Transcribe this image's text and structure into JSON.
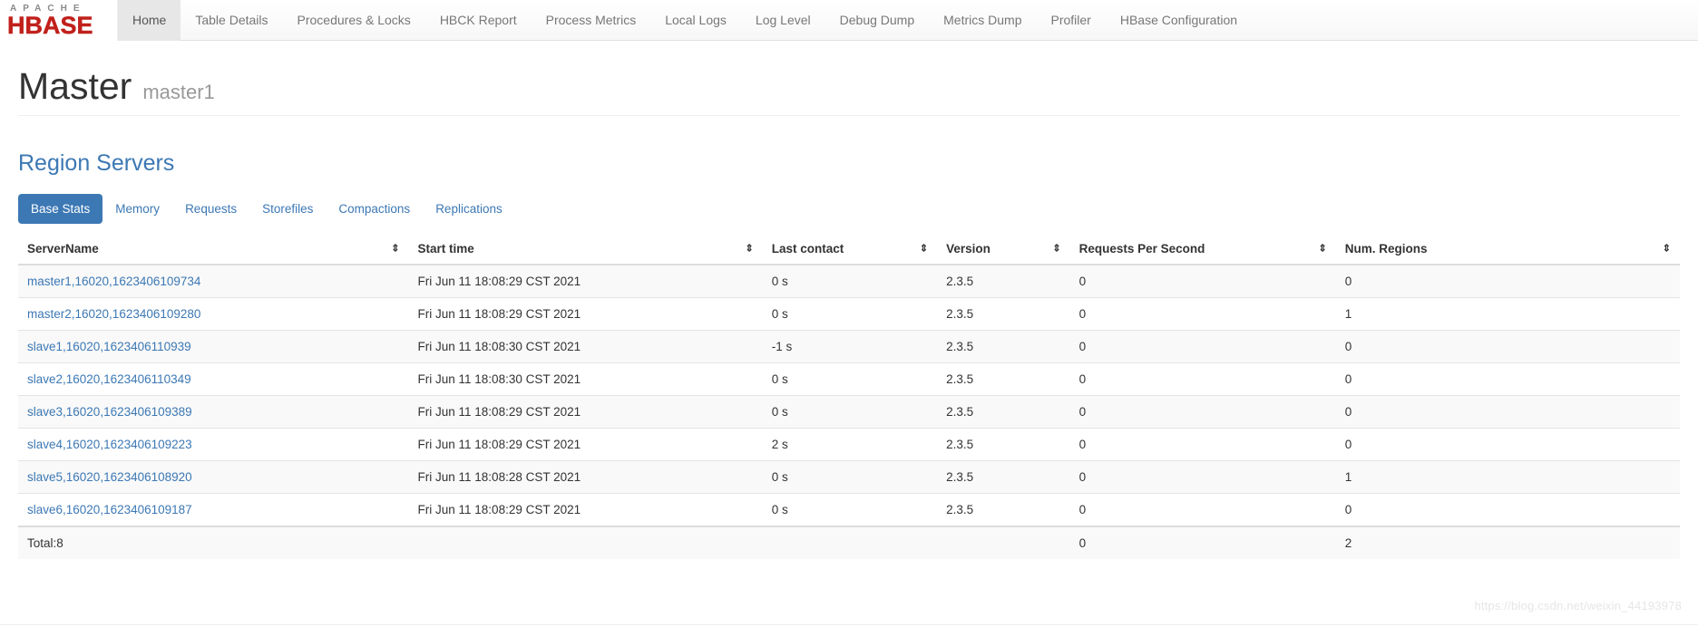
{
  "navbar": {
    "brand": {
      "top_text": "APACHE",
      "bottom_text": "HBASE"
    },
    "items": [
      {
        "label": "Home",
        "active": true
      },
      {
        "label": "Table Details",
        "active": false
      },
      {
        "label": "Procedures & Locks",
        "active": false
      },
      {
        "label": "HBCK Report",
        "active": false
      },
      {
        "label": "Process Metrics",
        "active": false
      },
      {
        "label": "Local Logs",
        "active": false
      },
      {
        "label": "Log Level",
        "active": false
      },
      {
        "label": "Debug Dump",
        "active": false
      },
      {
        "label": "Metrics Dump",
        "active": false
      },
      {
        "label": "Profiler",
        "active": false
      },
      {
        "label": "HBase Configuration",
        "active": false
      }
    ]
  },
  "page": {
    "title": "Master",
    "subtitle": "master1"
  },
  "region_servers": {
    "heading": "Region Servers",
    "tabs": [
      {
        "label": "Base Stats",
        "active": true
      },
      {
        "label": "Memory",
        "active": false
      },
      {
        "label": "Requests",
        "active": false
      },
      {
        "label": "Storefiles",
        "active": false
      },
      {
        "label": "Compactions",
        "active": false
      },
      {
        "label": "Replications",
        "active": false
      }
    ],
    "columns": [
      "ServerName",
      "Start time",
      "Last contact",
      "Version",
      "Requests Per Second",
      "Num. Regions"
    ],
    "sort_icon": "⇕",
    "rows": [
      {
        "server_name": "master1,16020,1623406109734",
        "start_time": "Fri Jun 11 18:08:29 CST 2021",
        "last_contact": "0 s",
        "version": "2.3.5",
        "requests_per_second": "0",
        "num_regions": "0"
      },
      {
        "server_name": "master2,16020,1623406109280",
        "start_time": "Fri Jun 11 18:08:29 CST 2021",
        "last_contact": "0 s",
        "version": "2.3.5",
        "requests_per_second": "0",
        "num_regions": "1"
      },
      {
        "server_name": "slave1,16020,1623406110939",
        "start_time": "Fri Jun 11 18:08:30 CST 2021",
        "last_contact": "-1 s",
        "version": "2.3.5",
        "requests_per_second": "0",
        "num_regions": "0"
      },
      {
        "server_name": "slave2,16020,1623406110349",
        "start_time": "Fri Jun 11 18:08:30 CST 2021",
        "last_contact": "0 s",
        "version": "2.3.5",
        "requests_per_second": "0",
        "num_regions": "0"
      },
      {
        "server_name": "slave3,16020,1623406109389",
        "start_time": "Fri Jun 11 18:08:29 CST 2021",
        "last_contact": "0 s",
        "version": "2.3.5",
        "requests_per_second": "0",
        "num_regions": "0"
      },
      {
        "server_name": "slave4,16020,1623406109223",
        "start_time": "Fri Jun 11 18:08:29 CST 2021",
        "last_contact": "2 s",
        "version": "2.3.5",
        "requests_per_second": "0",
        "num_regions": "0"
      },
      {
        "server_name": "slave5,16020,1623406108920",
        "start_time": "Fri Jun 11 18:08:28 CST 2021",
        "last_contact": "0 s",
        "version": "2.3.5",
        "requests_per_second": "0",
        "num_regions": "1"
      },
      {
        "server_name": "slave6,16020,1623406109187",
        "start_time": "Fri Jun 11 18:08:29 CST 2021",
        "last_contact": "0 s",
        "version": "2.3.5",
        "requests_per_second": "0",
        "num_regions": "0"
      }
    ],
    "total_row": {
      "label": "Total:8",
      "start_time": "",
      "last_contact": "",
      "version": "",
      "requests_per_second": "0",
      "num_regions": "2"
    }
  },
  "watermark": {
    "text": "https://blog.csdn.net/weixin_44193978"
  },
  "colors": {
    "brand_red": "#c1201b",
    "link_blue": "#3c78b4",
    "nav_text": "#777777",
    "active_tab_bg": "#e7e7e7"
  }
}
